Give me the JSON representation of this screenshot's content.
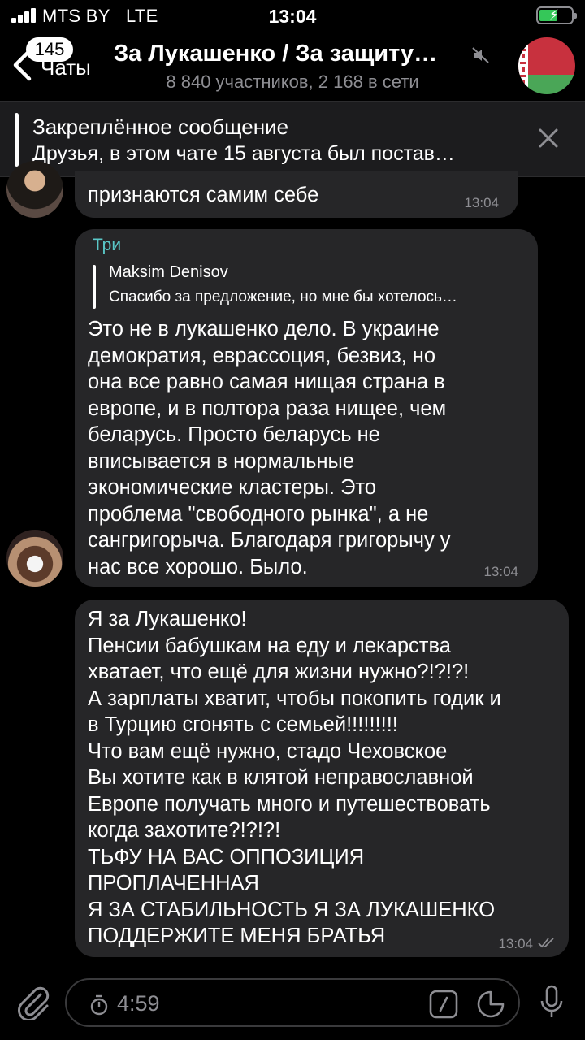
{
  "status_bar": {
    "carrier": "MTS BY",
    "network": "LTE",
    "time": "13:04"
  },
  "header": {
    "back_badge": "145",
    "back_label": "Чаты",
    "title": "За Лукашенко / За защиту…",
    "subtitle": "8 840 участников, 2 168 в сети"
  },
  "pinned": {
    "title": "Закреплённое сообщение",
    "text": "Друзья, в этом чате 15 августа был постав…"
  },
  "messages": [
    {
      "text": "признаются самим себе",
      "time": "13:04"
    },
    {
      "author": "Три",
      "reply_name": "Maksim Denisov",
      "reply_text": "Спасибо за предложение, но мне бы хотелось…",
      "text": "Это не в лукашенко дело. В украине\nдемократия, еврассоция, безвиз, но\nона все равно самая нищая страна в\nевропе, и в полтора раза нищее, чем\nбеларусь. Просто беларусь не\nвписывается в нормальные\nэкономические кластеры. Это\nпроблема \"свободного рынка\", а не\nсангригорыча. Благодаря григорычу у\nнас все хорошо. Было.",
      "time": "13:04"
    },
    {
      "text": "Я за Лукашенко!\nПенсии бабушкам на еду и лекарства\nхватает, что ещё для жизни нужно?!?!?!\nА зарплаты хватит, чтобы покопить годик и\nв Турцию сгонять с семьей!!!!!!!!!\nЧто вам ещё нужно, стадо Чеховское\nВы хотите как в клятой неправославной\nЕвропе получать много и путешествовать\nкогда захотите?!?!?!\nТЬФУ НА ВАС ОППОЗИЦИЯ\nПРОПЛАЧЕННАЯ\nЯ ЗА СТАБИЛЬНОСТЬ Я ЗА ЛУКАШЕНКО\nПОДДЕРЖИТЕ МЕНЯ БРАТЬЯ",
      "time": "13:04"
    }
  ],
  "input": {
    "slowmode_timer": "4:59"
  }
}
